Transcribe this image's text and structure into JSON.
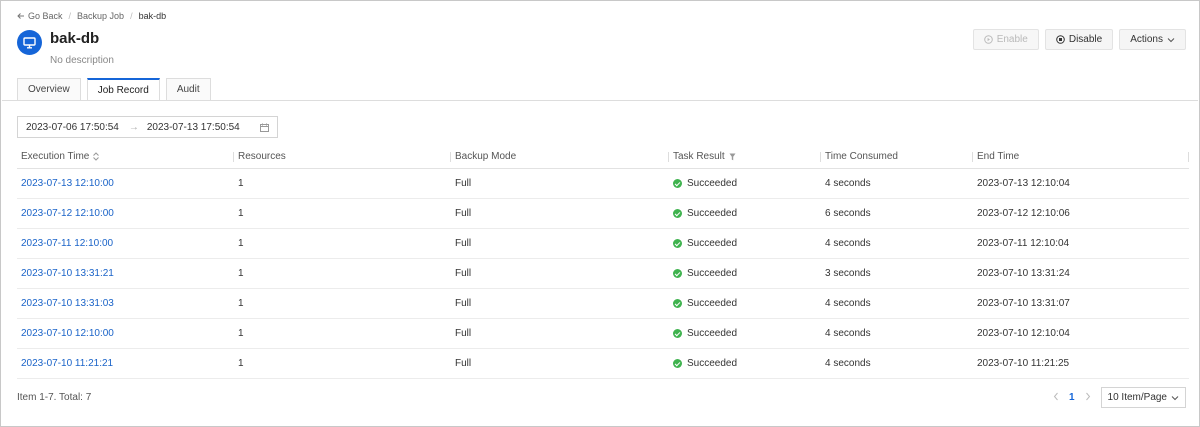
{
  "breadcrumb": {
    "back": "Go Back",
    "parent": "Backup Job",
    "current": "bak-db"
  },
  "header": {
    "title": "bak-db",
    "description": "No description"
  },
  "actions": {
    "enable": "Enable",
    "disable": "Disable",
    "more": "Actions"
  },
  "tabs": [
    "Overview",
    "Job Record",
    "Audit"
  ],
  "filter": {
    "start": "2023-07-06 17:50:54",
    "arrow": "→",
    "end": "2023-07-13 17:50:54"
  },
  "table": {
    "columns": [
      "Execution Time",
      "Resources",
      "Backup Mode",
      "Task Result",
      "Time Consumed",
      "End Time"
    ],
    "rows": [
      [
        "2023-07-13 12:10:00",
        "1",
        "Full",
        "Succeeded",
        "4 seconds",
        "2023-07-13 12:10:04"
      ],
      [
        "2023-07-12 12:10:00",
        "1",
        "Full",
        "Succeeded",
        "6 seconds",
        "2023-07-12 12:10:06"
      ],
      [
        "2023-07-11 12:10:00",
        "1",
        "Full",
        "Succeeded",
        "4 seconds",
        "2023-07-11 12:10:04"
      ],
      [
        "2023-07-10 13:31:21",
        "1",
        "Full",
        "Succeeded",
        "3 seconds",
        "2023-07-10 13:31:24"
      ],
      [
        "2023-07-10 13:31:03",
        "1",
        "Full",
        "Succeeded",
        "4 seconds",
        "2023-07-10 13:31:07"
      ],
      [
        "2023-07-10 12:10:00",
        "1",
        "Full",
        "Succeeded",
        "4 seconds",
        "2023-07-10 12:10:04"
      ],
      [
        "2023-07-10 11:21:21",
        "1",
        "Full",
        "Succeeded",
        "4 seconds",
        "2023-07-10 11:21:25"
      ]
    ]
  },
  "pagination": {
    "summary": "Item 1-7. Total: 7",
    "current_page": "1",
    "page_size": "10 Item/Page"
  },
  "colors": {
    "accent": "#1565d8",
    "link": "#1a63c8",
    "success": "#3fb34f"
  },
  "icons": {
    "back": "arrow-left-icon",
    "avatar": "monitor-icon",
    "enable": "play-circle-icon",
    "disable": "stop-circle-icon",
    "calendar": "calendar-icon",
    "sort": "sort-icon",
    "filter": "filter-icon",
    "success": "check-circle-icon"
  }
}
